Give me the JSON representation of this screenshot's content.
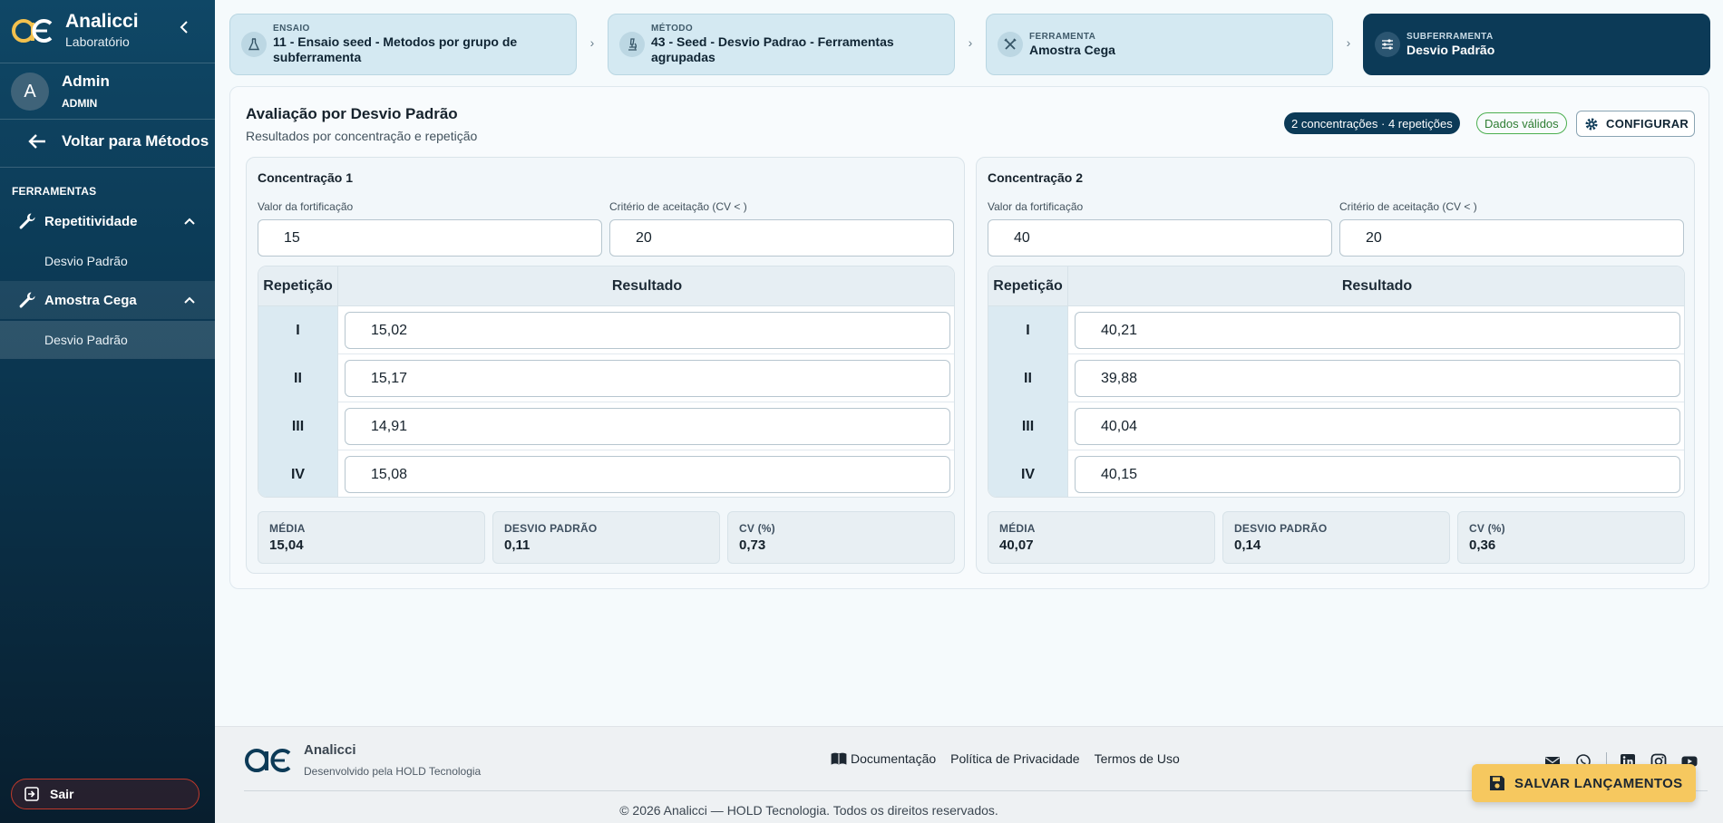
{
  "colors": {
    "sidebar": "#0b3650",
    "primary": "#0c3a57",
    "step_bg": "#d4e9f2",
    "accent_save": "#f6c85f",
    "valid": "#2e7d32",
    "logout": "#c0392b"
  },
  "sidebar": {
    "brand_name": "Analicci",
    "brand_sub": "Laboratório",
    "user": {
      "initial": "A",
      "name": "Admin",
      "role": "ADMIN"
    },
    "back_label": "Voltar para Métodos",
    "section_label": "FERRAMENTAS",
    "groups": [
      {
        "label": "Repetitividade",
        "icon": "wrench-icon",
        "items": [
          "Desvio Padrão"
        ]
      },
      {
        "label": "Amostra Cega",
        "icon": "wrench-icon",
        "items": [
          "Desvio Padrão"
        ]
      }
    ],
    "logout_label": "Sair"
  },
  "stepper": [
    {
      "caption": "ENSAIO",
      "title": "11 - Ensaio seed - Metodos por grupo de subferramenta",
      "icon": "flask-icon"
    },
    {
      "caption": "MÉTODO",
      "title": "43 - Seed - Desvio Padrao - Ferramentas agrupadas",
      "icon": "microscope-icon"
    },
    {
      "caption": "FERRAMENTA",
      "title": "Amostra Cega",
      "icon": "tools-icon"
    },
    {
      "caption": "SUBFERRAMENTA",
      "title": "Desvio Padrão",
      "icon": "sliders-icon"
    }
  ],
  "main": {
    "title": "Avaliação por Desvio Padrão",
    "subtitle": "Resultados por concentração e repetição",
    "badge_summary": "2 concentrações · 4 repetições",
    "badge_status": "Dados válidos",
    "config_label": "CONFIGURAR",
    "fortification_label": "Valor da fortificação",
    "criteria_label": "Critério de aceitação (CV < )",
    "col_rep": "Repetição",
    "col_result": "Resultado",
    "stat_labels": {
      "mean": "MÉDIA",
      "sd": "DESVIO PADRÃO",
      "cv": "CV (%)"
    },
    "concentrations": [
      {
        "title": "Concentração 1",
        "fortification": "15",
        "criteria": "20",
        "rows": [
          {
            "rep": "I",
            "value": "15,02"
          },
          {
            "rep": "II",
            "value": "15,17"
          },
          {
            "rep": "III",
            "value": "14,91"
          },
          {
            "rep": "IV",
            "value": "15,08"
          }
        ],
        "mean": "15,04",
        "sd": "0,11",
        "cv": "0,73"
      },
      {
        "title": "Concentração 2",
        "fortification": "40",
        "criteria": "20",
        "rows": [
          {
            "rep": "I",
            "value": "40,21"
          },
          {
            "rep": "II",
            "value": "39,88"
          },
          {
            "rep": "III",
            "value": "40,04"
          },
          {
            "rep": "IV",
            "value": "40,15"
          }
        ],
        "mean": "40,07",
        "sd": "0,14",
        "cv": "0,36"
      }
    ]
  },
  "footer": {
    "name": "Analicci",
    "sub": "Desenvolvido pela HOLD Tecnologia",
    "links": [
      "Documentação",
      "Política de Privacidade",
      "Termos de Uso"
    ],
    "social": [
      "mail-icon",
      "whatsapp-icon",
      "linkedin-icon",
      "instagram-icon",
      "youtube-icon"
    ],
    "copyright": "© 2026 Analicci — HOLD Tecnologia. Todos os direitos reservados."
  },
  "save_label": "SALVAR LANÇAMENTOS"
}
